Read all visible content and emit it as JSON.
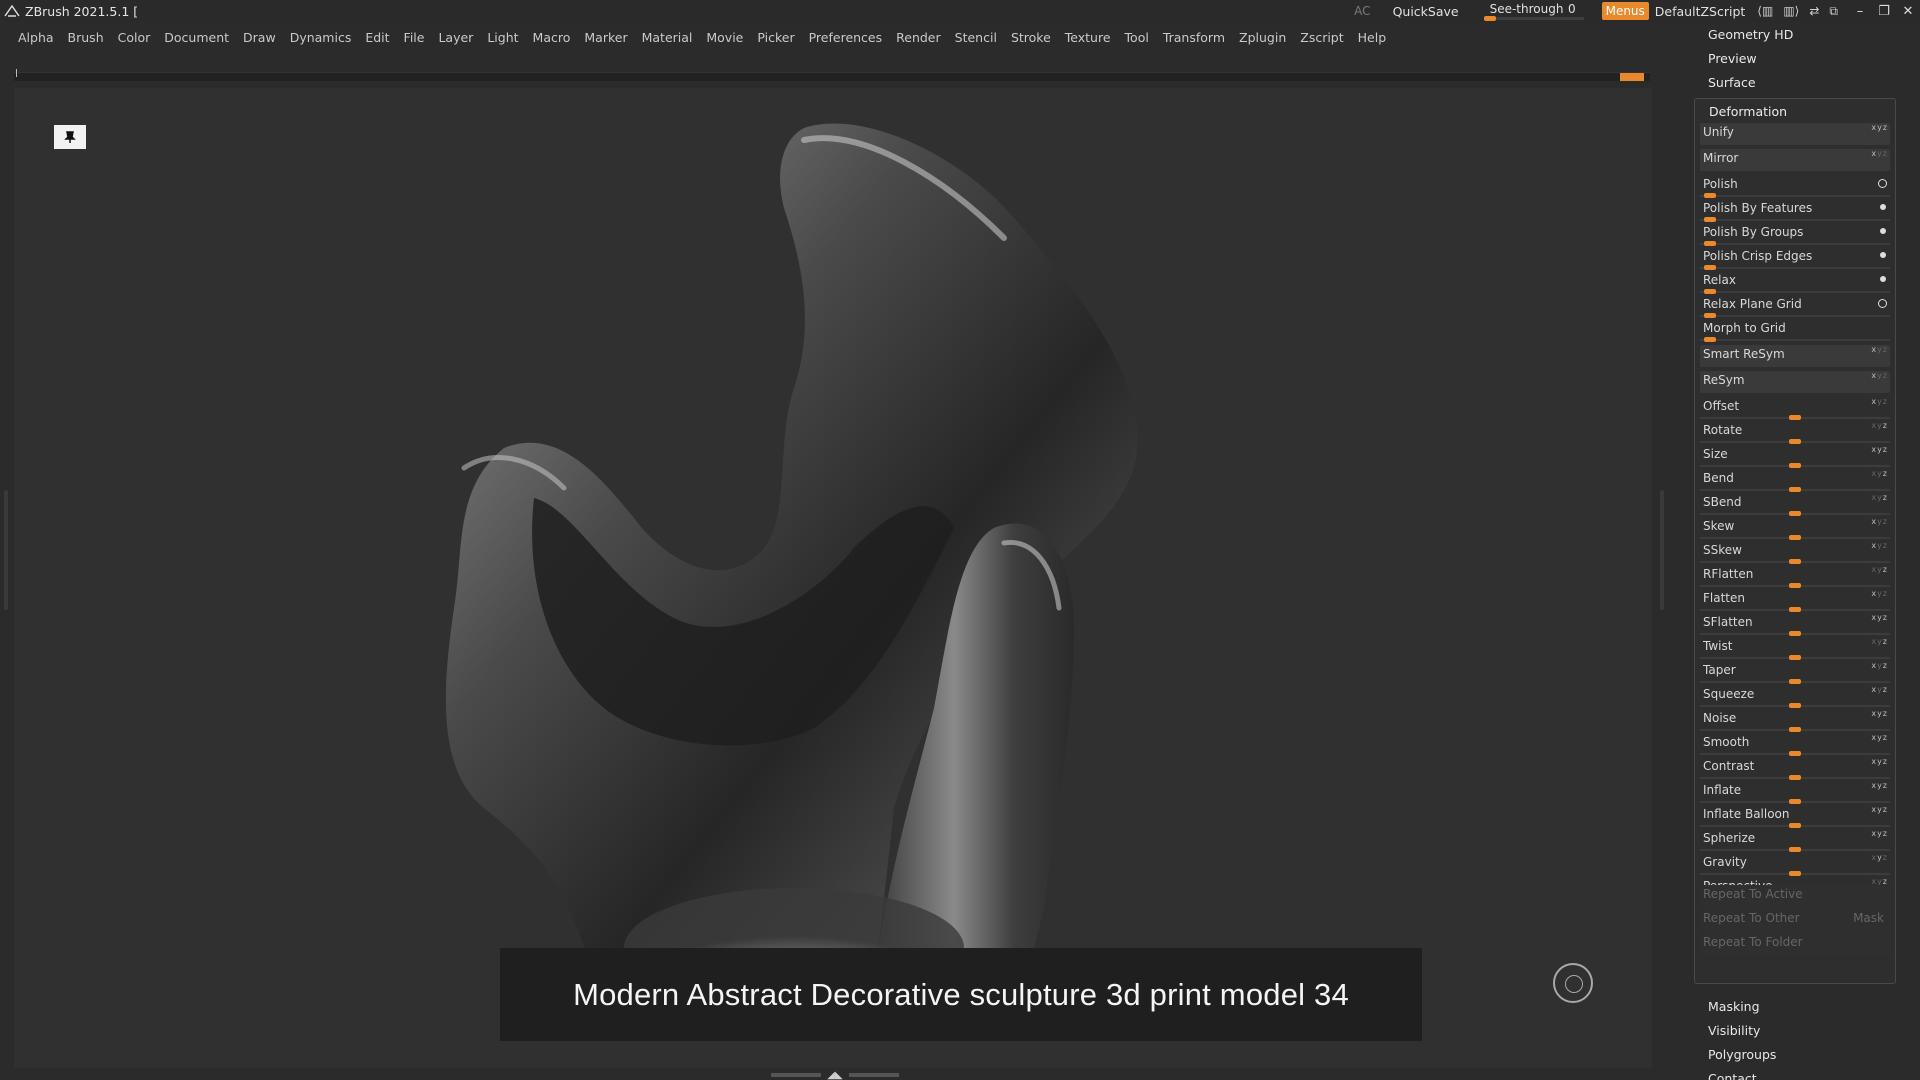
{
  "titlebar": {
    "app_title": "ZBrush 2021.5.1 [",
    "ac": "AC",
    "quicksave": "QuickSave",
    "see_through_label": "See-through",
    "see_through_value": "0",
    "menus": "Menus",
    "script": "DefaultZScript"
  },
  "menubar": {
    "items": [
      "Alpha",
      "Brush",
      "Color",
      "Document",
      "Draw",
      "Dynamics",
      "Edit",
      "File",
      "Layer",
      "Light",
      "Macro",
      "Marker",
      "Material",
      "Movie",
      "Picker",
      "Preferences",
      "Render",
      "Stencil",
      "Stroke",
      "Texture",
      "Tool",
      "Transform",
      "Zplugin",
      "Zscript",
      "Help"
    ]
  },
  "viewport": {
    "caption": "Modern Abstract Decorative sculpture 3d print model 34"
  },
  "rightpanel": {
    "top_sections": [
      "Geometry HD",
      "Preview",
      "Surface"
    ],
    "deformation": {
      "title": "Deformation",
      "rows": [
        {
          "label": "Unify",
          "kind": "button",
          "axis": "xyz"
        },
        {
          "label": "Mirror",
          "kind": "button",
          "axis": "x"
        },
        {
          "label": "Polish",
          "kind": "slider",
          "level": 0.02,
          "mark": "ring"
        },
        {
          "label": "Polish By Features",
          "kind": "slider",
          "level": 0.02,
          "mark": "dot"
        },
        {
          "label": "Polish By Groups",
          "kind": "slider",
          "level": 0.02,
          "mark": "dot"
        },
        {
          "label": "Polish Crisp Edges",
          "kind": "slider",
          "level": 0.02,
          "mark": "dot"
        },
        {
          "label": "Relax",
          "kind": "slider",
          "level": 0.02,
          "mark": "dot"
        },
        {
          "label": "Relax Plane Grid",
          "kind": "slider",
          "level": 0.02,
          "mark": "ring"
        },
        {
          "label": "Morph to Grid",
          "kind": "slider",
          "level": 0.02,
          "mark": ""
        },
        {
          "label": "Smart ReSym",
          "kind": "button",
          "axis": "x"
        },
        {
          "label": "ReSym",
          "kind": "button",
          "axis": "x"
        },
        {
          "label": "Offset",
          "kind": "slider",
          "level": 0.5,
          "axis": "x"
        },
        {
          "label": "Rotate",
          "kind": "slider",
          "level": 0.5,
          "axis": "z"
        },
        {
          "label": "Size",
          "kind": "slider",
          "level": 0.5,
          "axis": "xyz"
        },
        {
          "label": "Bend",
          "kind": "slider",
          "level": 0.5,
          "axis": "z"
        },
        {
          "label": "SBend",
          "kind": "slider",
          "level": 0.5,
          "axis": "z"
        },
        {
          "label": "Skew",
          "kind": "slider",
          "level": 0.5,
          "axis": "x"
        },
        {
          "label": "SSkew",
          "kind": "slider",
          "level": 0.5,
          "axis": "x"
        },
        {
          "label": "RFlatten",
          "kind": "slider",
          "level": 0.5,
          "axis": "z"
        },
        {
          "label": "Flatten",
          "kind": "slider",
          "level": 0.5,
          "axis": "x"
        },
        {
          "label": "SFlatten",
          "kind": "slider",
          "level": 0.5,
          "axis": "xyz"
        },
        {
          "label": "Twist",
          "kind": "slider",
          "level": 0.5,
          "axis": "z"
        },
        {
          "label": "Taper",
          "kind": "slider",
          "level": 0.5,
          "axis": "xz"
        },
        {
          "label": "Squeeze",
          "kind": "slider",
          "level": 0.5,
          "axis": "xz"
        },
        {
          "label": "Noise",
          "kind": "slider",
          "level": 0.5,
          "axis": "xyz"
        },
        {
          "label": "Smooth",
          "kind": "slider",
          "level": 0.5,
          "axis": "xyz"
        },
        {
          "label": "Contrast",
          "kind": "slider",
          "level": 0.5,
          "axis": "xyz"
        },
        {
          "label": "Inflate",
          "kind": "slider",
          "level": 0.5,
          "axis": "xyz"
        },
        {
          "label": "Inflate Balloon",
          "kind": "slider",
          "level": 0.5,
          "axis": "xyz"
        },
        {
          "label": "Spherize",
          "kind": "slider",
          "level": 0.5,
          "axis": "xyz"
        },
        {
          "label": "Gravity",
          "kind": "slider",
          "level": 0.5,
          "axis": "y"
        },
        {
          "label": "Perspective",
          "kind": "slider",
          "level": 0.5,
          "axis": "z"
        }
      ],
      "repeat_active": "Repeat To Active",
      "repeat_other": "Repeat To Other",
      "mask": "Mask",
      "repeat_folder": "Repeat To Folder"
    },
    "bottom_sections": [
      "Masking",
      "Visibility",
      "Polygroups",
      "Contact"
    ]
  },
  "colors": {
    "accent": "#e8892b",
    "panel": "#2b2b2b",
    "viewport": "#303030"
  }
}
